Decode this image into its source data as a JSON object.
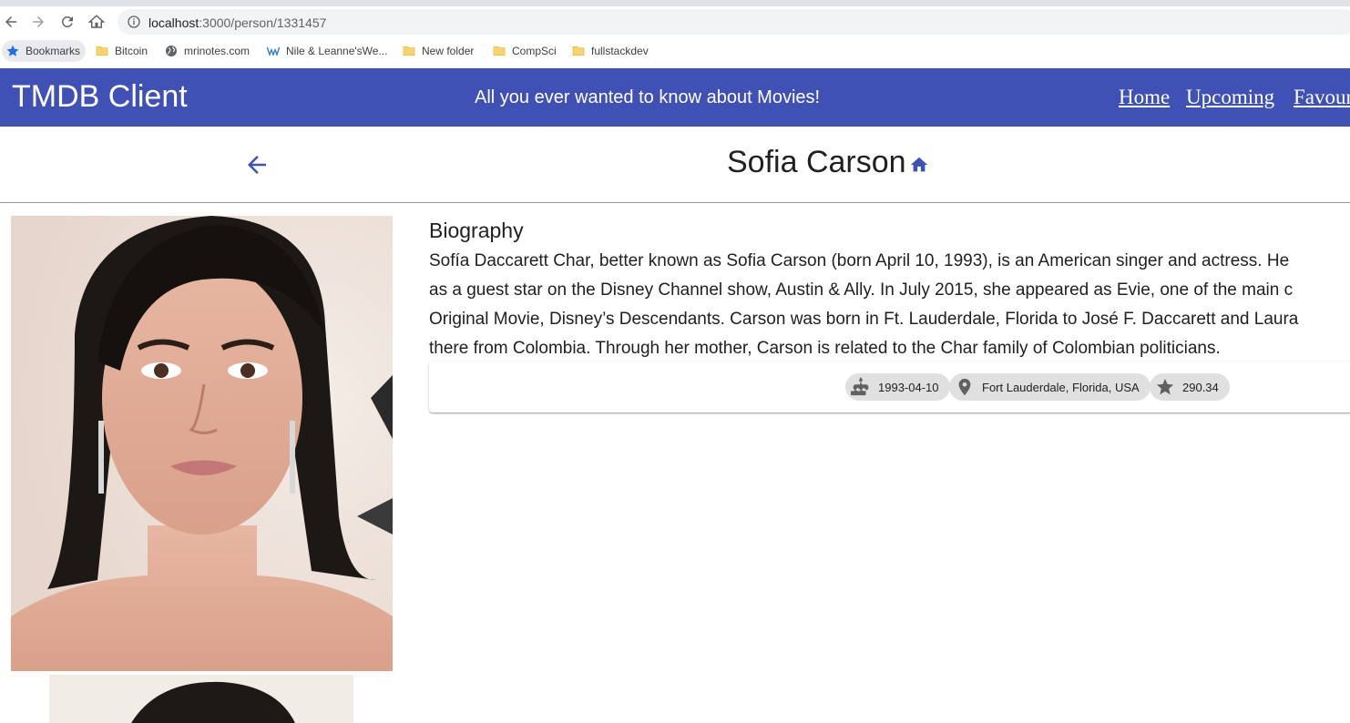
{
  "browser": {
    "url_host": "localhost",
    "url_path": ":3000/person/1331457",
    "bookmarks": [
      {
        "label": "Bookmarks",
        "icon": "star-icon"
      },
      {
        "label": "Bitcoin",
        "icon": "folder-icon"
      },
      {
        "label": "mrinotes.com",
        "icon": "globe-icon"
      },
      {
        "label": "Nile & Leanne'sWe...",
        "icon": "wix-icon"
      },
      {
        "label": "New folder",
        "icon": "folder-icon"
      },
      {
        "label": "CompSci",
        "icon": "folder-icon"
      },
      {
        "label": "fullstackdev",
        "icon": "folder-icon"
      }
    ]
  },
  "header": {
    "brand": "TMDB Client",
    "tagline": "All you ever wanted to know about Movies!",
    "nav": [
      "Home",
      "Upcoming",
      "Favour"
    ]
  },
  "person": {
    "name": "Sofia Carson",
    "biography_heading": "Biography",
    "biography_lines": [
      "Sofía Daccarett Char, better known as Sofia Carson (born April 10, 1993), is an American singer and actress. He",
      "as a guest star on the Disney Channel show, Austin & Ally. In July 2015, she appeared as Evie, one of the main c",
      "Original Movie, Disney’s Descendants. Carson was born in Ft. Lauderdale, Florida to José F. Daccarett and Laura",
      "there from Colombia. Through her mother, Carson is related to the Char family of Colombian politicians."
    ],
    "birthday": "1993-04-10",
    "birthplace": "Fort Lauderdale, Florida, USA",
    "popularity": "290.34"
  },
  "colors": {
    "primary": "#3f51b5",
    "chip": "#e0e0e0",
    "icon_grey": "#616161"
  }
}
